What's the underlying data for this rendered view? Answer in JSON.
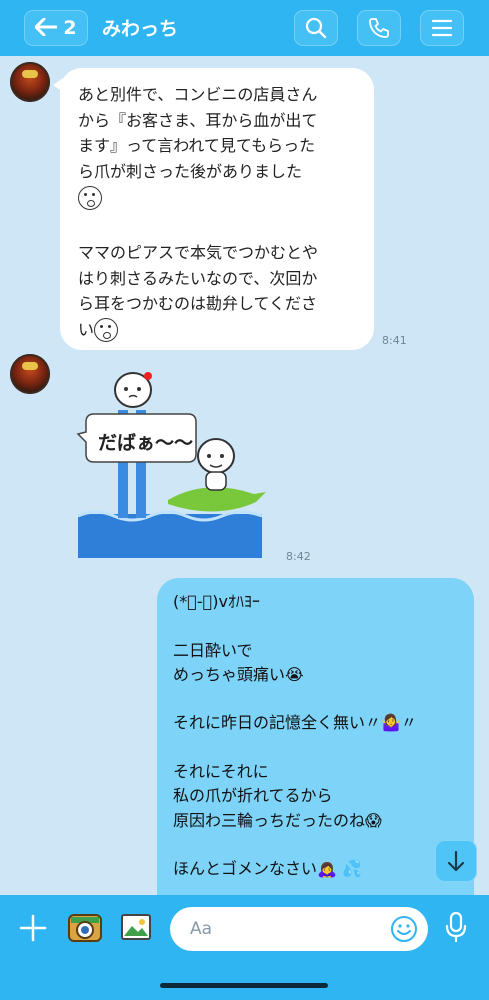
{
  "header": {
    "back_count": "2",
    "title": "みわっち",
    "icons": [
      "back-arrow-icon",
      "search-icon",
      "phone-icon",
      "menu-icon"
    ]
  },
  "messages": {
    "incoming": {
      "lines": [
        "あと別件で、コンビニの店員さん",
        "から『お客さま、耳から血が出て",
        "ます』って言われて見てもらった",
        "ら爪が刺さった後がありました"
      ],
      "lines2": [
        "ママのピアスで本気でつかむとや",
        "はり刺さるみたいなので、次回か",
        "ら耳をつかむのは勘弁してくださ",
        "い"
      ],
      "time": "8:41"
    },
    "sticker": {
      "text": "だばぁ～～",
      "time": "8:42"
    },
    "outgoing": {
      "lines": [
        "(*ﾟ-ﾟ)vｵﾊﾖｰ",
        "",
        "二日酔いで",
        "めっちゃ頭痛い😭",
        "",
        "それに昨日の記憶全く無い〃🤷‍♀️〃",
        "",
        "それにそれに",
        "私の爪が折れてるから",
        "原因わ三輪っちだったのね😱",
        "",
        "ほんとゴメンなさい🙇‍♀️ 💦"
      ]
    }
  },
  "composer": {
    "placeholder": "Aa",
    "icons": [
      "plus-icon",
      "camera-icon",
      "image-icon",
      "emoji-icon",
      "mic-icon"
    ]
  },
  "colors": {
    "header": "#2fb6f2",
    "background": "#cfe6f6",
    "outgoing_bubble": "#7ed3f9",
    "incoming_bubble": "#ffffff"
  }
}
